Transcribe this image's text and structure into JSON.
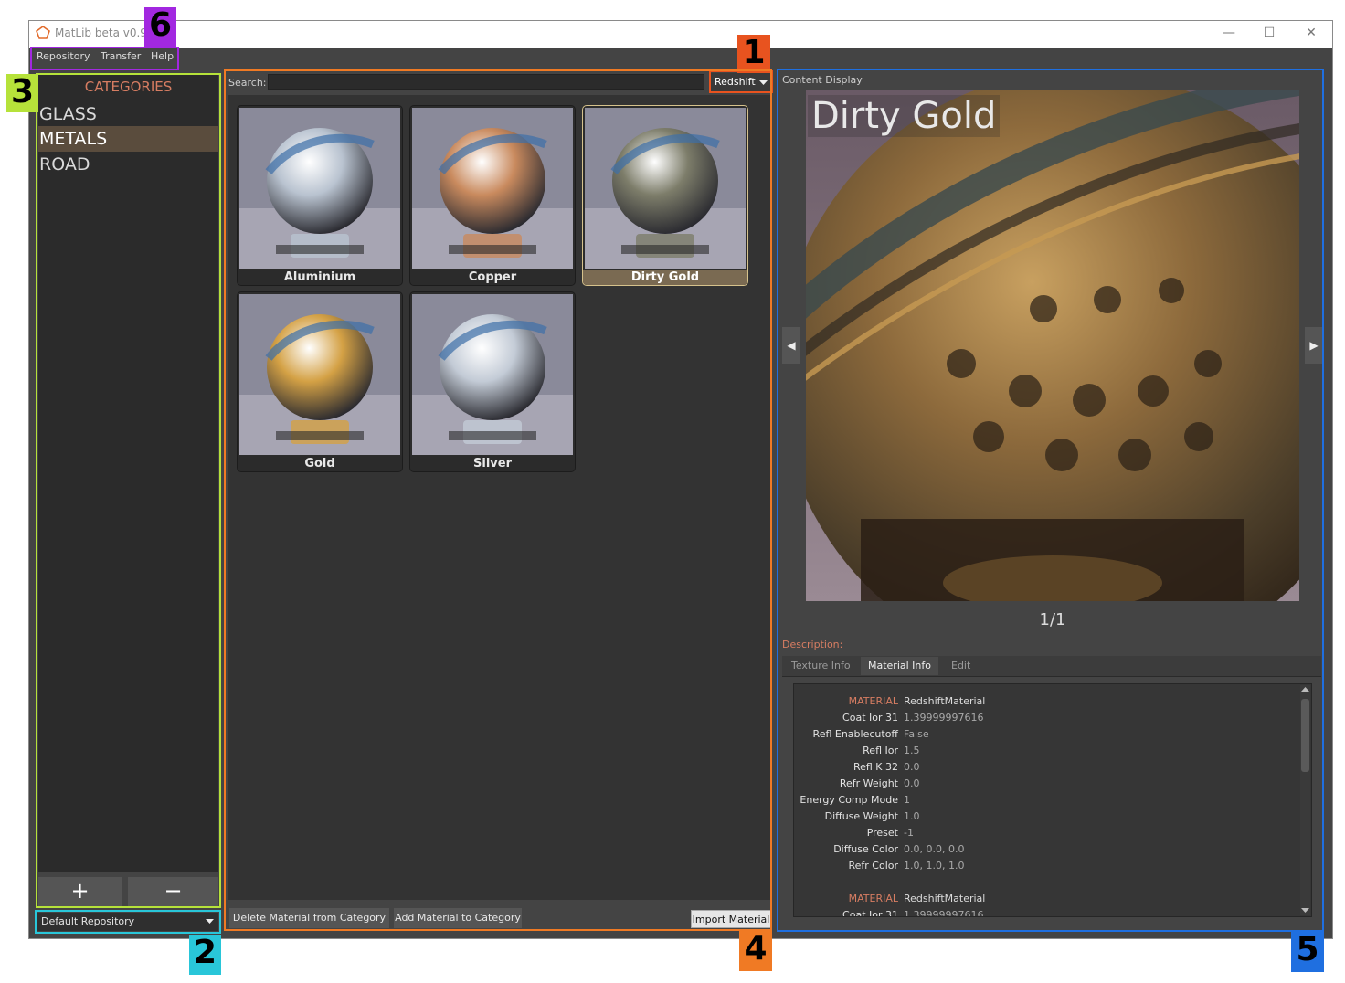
{
  "window": {
    "title": "MatLib beta v0.9",
    "controls": {
      "minimize": "—",
      "maximize": "☐",
      "close": "✕"
    }
  },
  "menu": [
    "Repository",
    "Transfer",
    "Help"
  ],
  "categories": {
    "header": "CATEGORIES",
    "items": [
      "GLASS",
      "METALS",
      "ROAD"
    ],
    "selected": "METALS",
    "add_button": "+",
    "remove_button": "−"
  },
  "repository_dropdown": {
    "selected": "Default Repository"
  },
  "search": {
    "label": "Search:",
    "value": ""
  },
  "renderer_dropdown": {
    "selected": "Redshift"
  },
  "materials": [
    {
      "name": "Aluminium",
      "tone": "#b9c3d0",
      "selected": false
    },
    {
      "name": "Copper",
      "tone": "#c98a5e",
      "selected": false
    },
    {
      "name": "Dirty Gold",
      "tone": "#7d7d6a",
      "selected": true
    },
    {
      "name": "Gold",
      "tone": "#d4a145",
      "selected": false
    },
    {
      "name": "Silver",
      "tone": "#c3cbd6",
      "selected": false
    }
  ],
  "bottom_buttons": {
    "delete": "Delete Material from Category",
    "add": "Add Material to Category",
    "import": "Import Material"
  },
  "content_display": {
    "label": "Content Display",
    "title": "Dirty Gold",
    "counter": "1/1",
    "prev_arrow": "◀",
    "next_arrow": "▶"
  },
  "description": {
    "label": "Description:",
    "tabs": [
      "Texture Info",
      "Material Info",
      "Edit"
    ],
    "active_tab": "Material Info",
    "rows": [
      {
        "key": "MATERIAL",
        "value": "RedshiftMaterial",
        "highlight": true
      },
      {
        "key": "Coat Ior 31",
        "value": "1.39999997616"
      },
      {
        "key": "Refl Enablecutoff",
        "value": "False"
      },
      {
        "key": "Refl Ior",
        "value": "1.5"
      },
      {
        "key": "Refl K 32",
        "value": "0.0"
      },
      {
        "key": "Refr Weight",
        "value": "0.0"
      },
      {
        "key": "Energy Comp Mode",
        "value": "1"
      },
      {
        "key": "Diffuse Weight",
        "value": "1.0"
      },
      {
        "key": "Preset",
        "value": "-1"
      },
      {
        "key": "Diffuse Color",
        "value": "0.0, 0.0, 0.0"
      },
      {
        "key": "Refr Color",
        "value": "1.0, 1.0, 1.0"
      },
      {
        "key": "",
        "value": ""
      },
      {
        "key": "MATERIAL",
        "value": "RedshiftMaterial",
        "highlight": true
      },
      {
        "key": "Coat Ior 31",
        "value": "1.39999997616"
      }
    ]
  },
  "annotations": {
    "badge1": "1",
    "badge2": "2",
    "badge3": "3",
    "badge4": "4",
    "badge5": "5",
    "badge6": "6"
  },
  "colors": {
    "accent": "#d77d62",
    "selection": "#5a4c3d",
    "box1": "#e8531f",
    "box2": "#29c6d9",
    "box3": "#b6e23a",
    "box4": "#f07a24",
    "box5": "#1f6fe0",
    "box6": "#a228e0"
  }
}
